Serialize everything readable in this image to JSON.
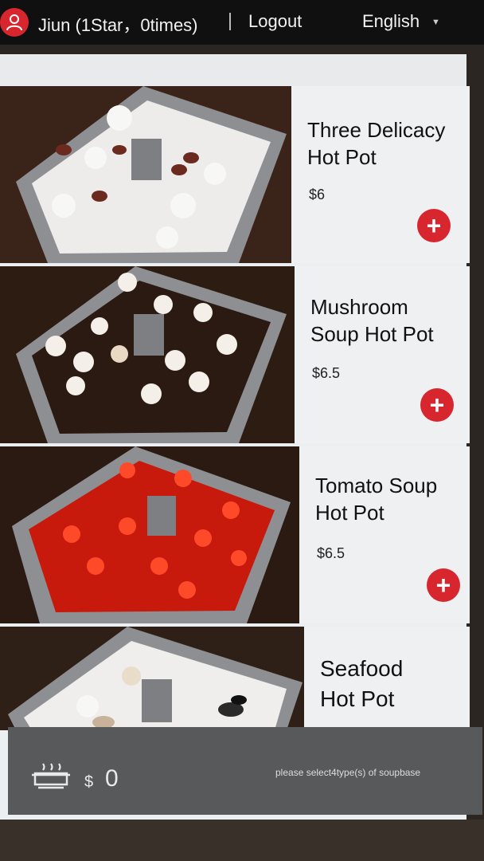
{
  "header": {
    "user_label": "Jiun (1Star，0times)",
    "logout_label": "Logout",
    "language_label": "English"
  },
  "menu": {
    "items": [
      {
        "name_line1": "Three Delicacy",
        "name_line2": "Hot Pot",
        "price": "$6"
      },
      {
        "name_line1": "Mushroom",
        "name_line2": "Soup Hot Pot",
        "price": "$6.5"
      },
      {
        "name_line1": "Tomato Soup",
        "name_line2": "Hot Pot",
        "price": "$6.5"
      },
      {
        "name_line1": "Seafood",
        "name_line2": "Hot Pot",
        "price": ""
      }
    ],
    "add_symbol": "+"
  },
  "cart": {
    "currency": "$",
    "total": "0",
    "hint": "please select4type(s) of soupbase"
  },
  "colors": {
    "accent": "#d8262f",
    "topbar": "#101010",
    "bottombar": "#58595b"
  }
}
